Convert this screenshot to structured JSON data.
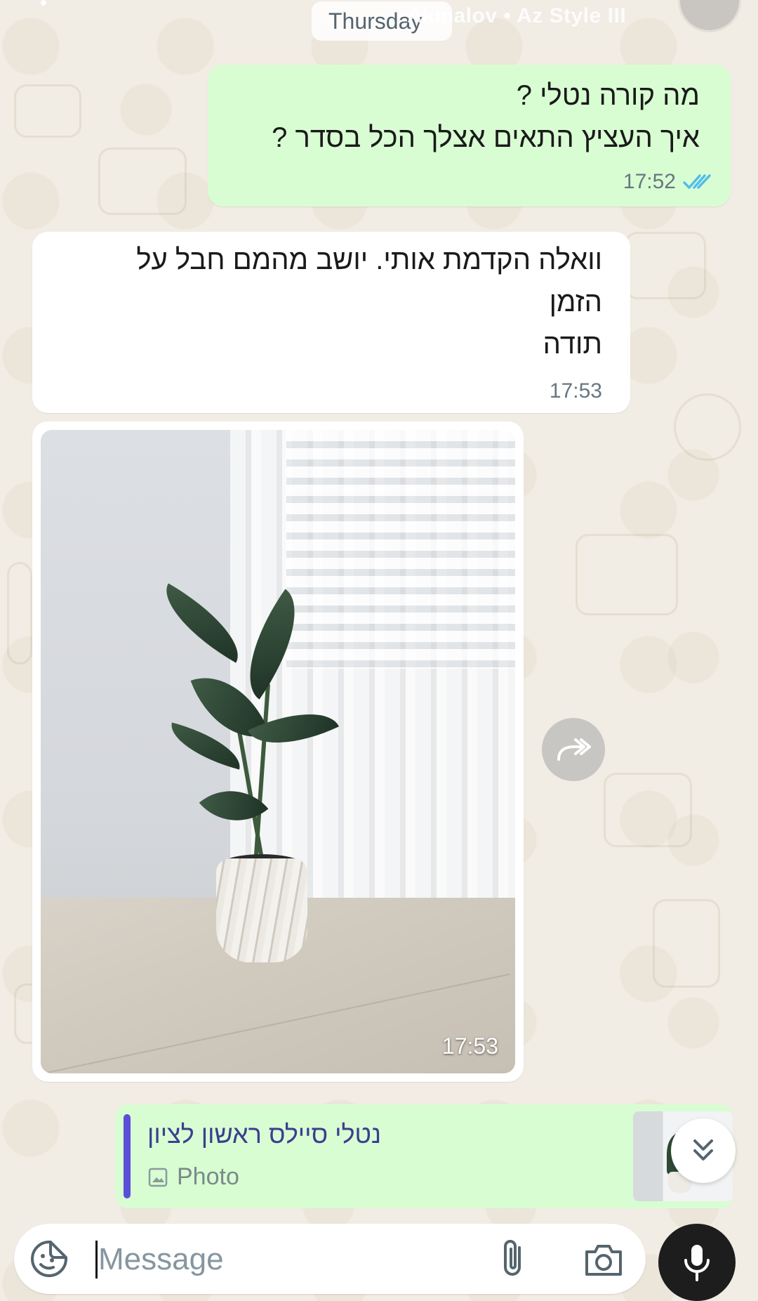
{
  "header": {
    "date_label": "Thursday",
    "watermark": "Akmalov • Az Style III"
  },
  "messages": [
    {
      "direction": "outgoing",
      "lines": [
        "מה קורה נטלי ?",
        "איך העציץ התאים אצלך הכל בסדר ?"
      ],
      "time": "17:52",
      "status_icon": "double-check-read-icon",
      "status_color": "#53bdeb"
    },
    {
      "direction": "incoming",
      "lines": [
        "וואלה הקדמת אותי. יושב מהמם חבל על",
        "הזמן",
        "תודה"
      ],
      "time": "17:53"
    },
    {
      "direction": "incoming",
      "type": "photo",
      "time": "17:53"
    }
  ],
  "reply_preview": {
    "sender": "נטלי סיילס ראשון לציון",
    "media_label": "Photo",
    "accent_color": "#5b4fd8"
  },
  "composer": {
    "placeholder": "Message"
  },
  "colors": {
    "outgoing_bubble": "#d9fdd3",
    "incoming_bubble": "#ffffff",
    "background": "#efeae2",
    "mic_button": "#1d1d1d"
  }
}
